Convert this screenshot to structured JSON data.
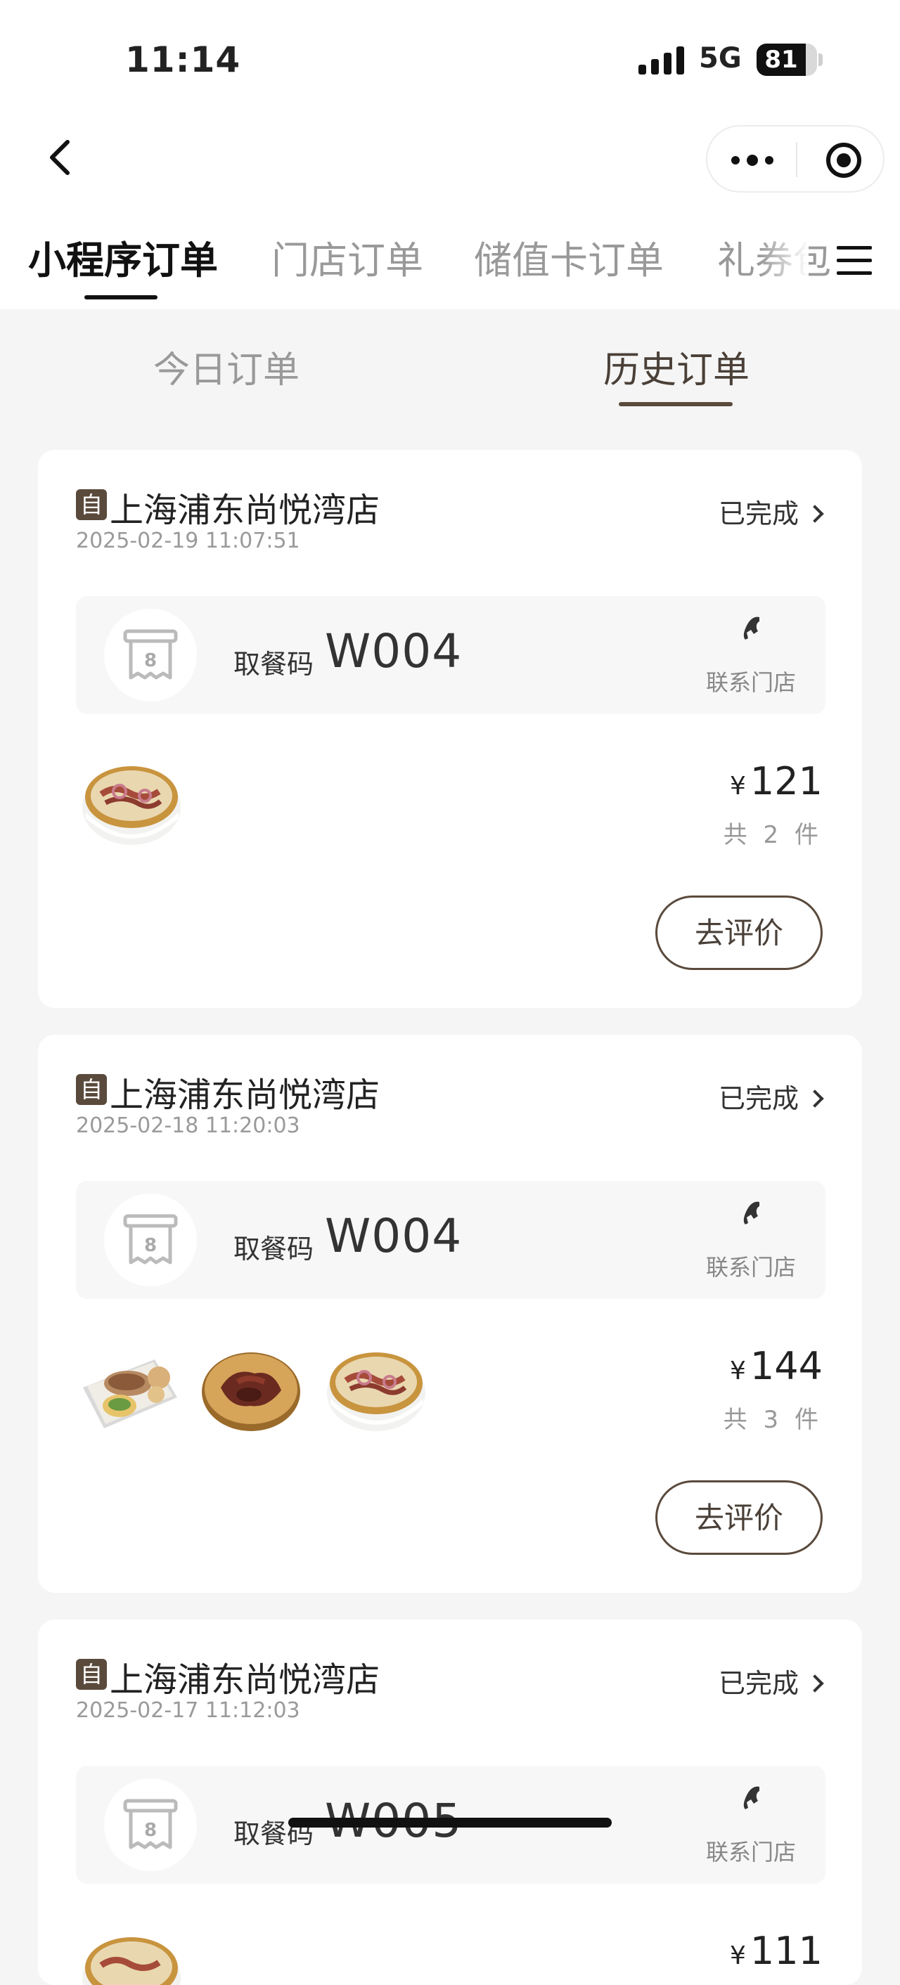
{
  "status_bar": {
    "time": "11:14",
    "network": "5G",
    "battery": "81",
    "battery_level": 0.81
  },
  "nav": {
    "tabs": [
      {
        "label": "小程序订单",
        "active": true
      },
      {
        "label": "门店订单",
        "active": false
      },
      {
        "label": "储值卡订单",
        "active": false
      },
      {
        "label": "礼券包",
        "active": false
      }
    ]
  },
  "sub_tabs": [
    {
      "label": "今日订单",
      "active": false
    },
    {
      "label": "历史订单",
      "active": true
    }
  ],
  "colors": {
    "accent": "#5a4a3c",
    "page_bg": "#f5f5f5",
    "muted": "#999999"
  },
  "orders": [
    {
      "store_badge": "自",
      "store": "上海浦东尚悦湾店",
      "time": "2025-02-19 11:07:51",
      "status": "已完成",
      "pickup_label": "取餐码",
      "pickup_code": "W004",
      "ticket_num": "8",
      "contact": "联系门店",
      "currency": "¥",
      "total": "121",
      "count": "共 2 件",
      "action": "去评价",
      "items": [
        "noodle-bowl"
      ]
    },
    {
      "store_badge": "自",
      "store": "上海浦东尚悦湾店",
      "time": "2025-02-18 11:20:03",
      "status": "已完成",
      "pickup_label": "取餐码",
      "pickup_code": "W004",
      "ticket_num": "8",
      "contact": "联系门店",
      "currency": "¥",
      "total": "144",
      "count": "共 3 件",
      "action": "去评价",
      "items": [
        "meal-tray",
        "braised-duck",
        "noodle-bowl"
      ]
    },
    {
      "store_badge": "自",
      "store": "上海浦东尚悦湾店",
      "time": "2025-02-17 11:12:03",
      "status": "已完成",
      "pickup_label": "取餐码",
      "pickup_code": "W005",
      "ticket_num": "8",
      "contact": "联系门店",
      "currency": "¥",
      "total": "111",
      "items": [
        "noodle-bowl"
      ]
    }
  ]
}
